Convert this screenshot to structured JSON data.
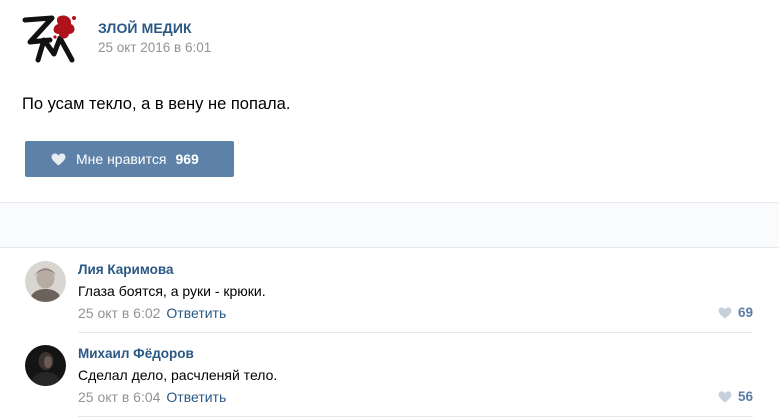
{
  "post": {
    "group_name": "ЗЛОЙ МЕДИК",
    "time": "25 окт 2016 в 6:01",
    "text": "По усам текло, а в вену не попала.",
    "logo_icon": "zm-logo-icon",
    "like": {
      "label": "Мне нравится",
      "count": "969",
      "icon": "heart-icon"
    }
  },
  "comments": [
    {
      "author": "Лия Каримова",
      "text": "Глаза боятся, а руки - крюки.",
      "time": "25 окт в 6:02",
      "reply_label": "Ответить",
      "likes": "69"
    },
    {
      "author": "Михаил Фёдоров",
      "text": "Сделал дело, расчленяй тело.",
      "time": "25 окт в 6:04",
      "reply_label": "Ответить",
      "likes": "56"
    }
  ],
  "colors": {
    "link": "#2a5885",
    "like_button": "#5e81a8",
    "meta": "#939393",
    "logo_red": "#b0121b"
  }
}
